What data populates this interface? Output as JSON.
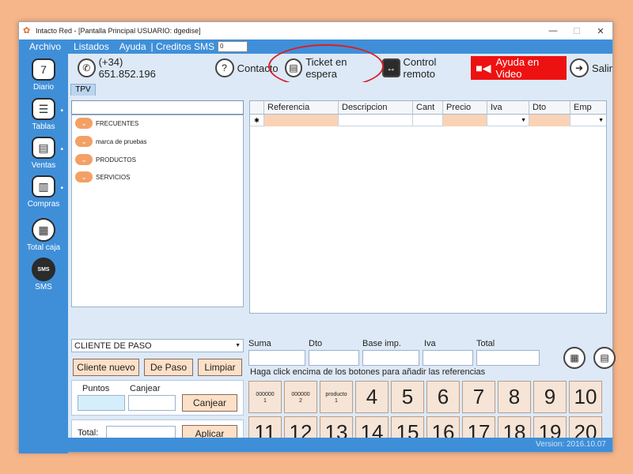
{
  "window": {
    "title": "Intacto Red - [Pantalla Principal USUARIO: dgedise]",
    "minimize_glyph": "—",
    "maximize_glyph": "☐",
    "close_glyph": "✕"
  },
  "menu": {
    "archivo": "Archivo",
    "listados": "Listados",
    "ayuda": "Ayuda",
    "creditos": "| Creditos SMS",
    "sms_value": "0"
  },
  "sidebar": [
    {
      "label": "Diario",
      "icon": "calendar-icon",
      "glyph": "7"
    },
    {
      "label": "Tablas",
      "icon": "table-icon",
      "glyph": "☰"
    },
    {
      "label": "Ventas",
      "icon": "sales-document-icon",
      "glyph": "▤"
    },
    {
      "label": "Compras",
      "icon": "purchases-clipboard-icon",
      "glyph": "▥"
    },
    {
      "label": "Total caja",
      "icon": "cash-register-icon",
      "glyph": "▦"
    },
    {
      "label": "SMS",
      "icon": "sms-bubble-icon",
      "glyph": "SMS"
    }
  ],
  "toolbar": {
    "phone": "(+34) 651.852.196",
    "contacto": "Contacto",
    "ticket": "Ticket en espera",
    "control": "Control remoto",
    "video": "Ayuda en Video",
    "salir": "Salir"
  },
  "tab": "TPV",
  "tree": [
    "FRECUENTES",
    "marca de pruebas",
    "PRODUCTOS",
    "SERVICIOS"
  ],
  "grid": {
    "columns": [
      "Referencia",
      "Descripcion",
      "Cant",
      "Precio",
      "Iva",
      "Dto",
      "Emp"
    ],
    "row_marker": "✱"
  },
  "client": {
    "selected": "CLIENTE DE PASO",
    "cliente_nuevo": "Cliente nuevo",
    "de_paso": "De Paso",
    "limpiar": "Limpiar",
    "puntos": "Puntos",
    "canjear_label": "Canjear",
    "canjear_btn": "Canjear",
    "total": "Total:",
    "aplicar": "Aplicar"
  },
  "totals": {
    "suma": "Suma",
    "dto": "Dto",
    "base": "Base imp.",
    "iva": "Iva",
    "total": "Total"
  },
  "hint": "Haga click encima de los botones para añadir las referencias",
  "refs_small": [
    {
      "line1": "000000",
      "line2": "1"
    },
    {
      "line1": "000000",
      "line2": "2"
    },
    {
      "line1": "producto",
      "line2": "1"
    }
  ],
  "refs_row1": [
    "4",
    "5",
    "6",
    "7",
    "8",
    "9",
    "10"
  ],
  "refs_row2": [
    "11",
    "12",
    "13",
    "14",
    "15",
    "16",
    "17",
    "18",
    "19",
    "20"
  ],
  "version": "Version: 2016.10.07",
  "accent": "#3f8fd8",
  "highlight": "#d8202a"
}
